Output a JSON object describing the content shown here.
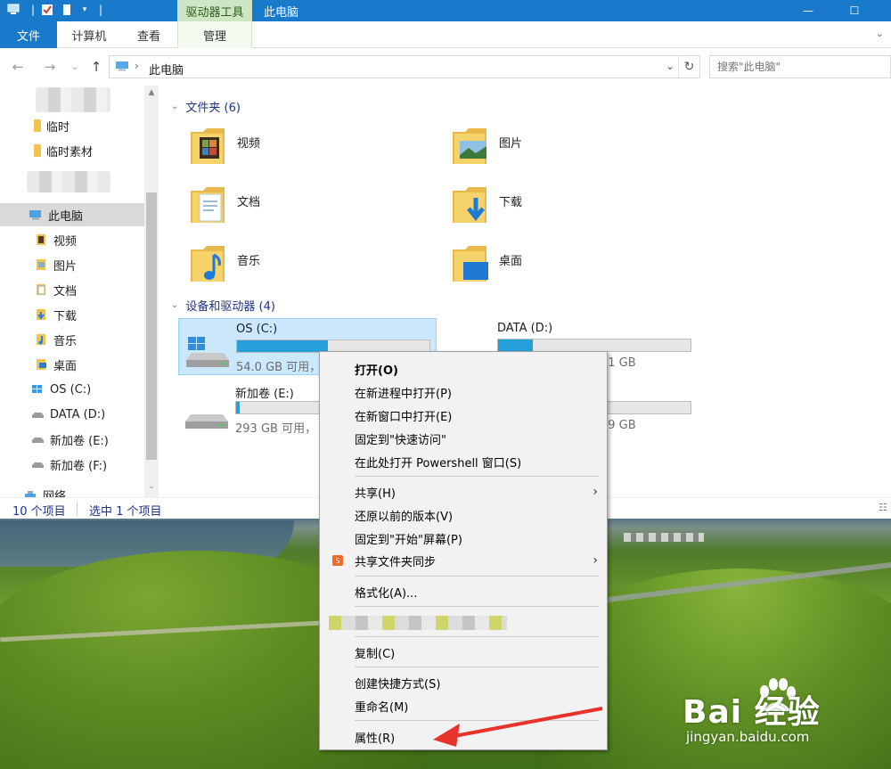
{
  "titlebar": {
    "context_tab": "驱动器工具",
    "title": "此电脑"
  },
  "ribbon": {
    "tabs": [
      {
        "label": "文件"
      },
      {
        "label": "计算机"
      },
      {
        "label": "查看"
      },
      {
        "label": "管理"
      }
    ]
  },
  "address": {
    "crumb": "此电脑",
    "search_placeholder": "搜索\"此电脑\""
  },
  "nav": {
    "quick": [
      {
        "label": "临时"
      },
      {
        "label": "临时素材"
      }
    ],
    "this_pc": "此电脑",
    "pc_items": [
      {
        "label": "视频"
      },
      {
        "label": "图片"
      },
      {
        "label": "文档"
      },
      {
        "label": "下载"
      },
      {
        "label": "音乐"
      },
      {
        "label": "桌面"
      },
      {
        "label": "OS (C:)"
      },
      {
        "label": "DATA (D:)"
      },
      {
        "label": "新加卷 (E:)"
      },
      {
        "label": "新加卷 (F:)"
      }
    ],
    "network": "网络"
  },
  "content": {
    "folders_header": "文件夹 (6)",
    "folders": [
      {
        "name": "视频",
        "icon": "video-folder-icon"
      },
      {
        "name": "图片",
        "icon": "pictures-folder-icon"
      },
      {
        "name": "文档",
        "icon": "documents-folder-icon"
      },
      {
        "name": "下载",
        "icon": "downloads-folder-icon"
      },
      {
        "name": "音乐",
        "icon": "music-folder-icon"
      },
      {
        "name": "桌面",
        "icon": "desktop-folder-icon"
      }
    ],
    "drives_header": "设备和驱动器 (4)",
    "drives": [
      {
        "name": "OS (C:)",
        "free": "54.0 GB 可用，",
        "used_fraction": 0.47
      },
      {
        "name": "DATA (D:)",
        "free": "31 GB",
        "used_fraction": 0.18
      },
      {
        "name": "新加卷 (E:)",
        "free": "293 GB 可用，",
        "used_fraction": 0.02
      },
      {
        "name": "",
        "free": "99 GB",
        "used_fraction": 0.0
      }
    ]
  },
  "status": {
    "count": "10 个项目",
    "selected": "选中 1 个项目"
  },
  "context_menu": {
    "items": [
      {
        "label": "打开(O)"
      },
      {
        "label": "在新进程中打开(P)"
      },
      {
        "label": "在新窗口中打开(E)"
      },
      {
        "label": "固定到\"快速访问\""
      },
      {
        "label": "在此处打开 Powershell 窗口(S)"
      },
      {
        "label": "共享(H)"
      },
      {
        "label": "还原以前的版本(V)"
      },
      {
        "label": "固定到\"开始\"屏幕(P)"
      },
      {
        "label": "共享文件夹同步"
      },
      {
        "label": "格式化(A)..."
      },
      {
        "label": "复制(C)"
      },
      {
        "label": "创建快捷方式(S)"
      },
      {
        "label": "重命名(M)"
      },
      {
        "label": "属性(R)"
      }
    ]
  },
  "watermark": {
    "logo": "Bai  经验",
    "url": "jingyan.baidu.com"
  },
  "colors": {
    "accent": "#1979ca",
    "context_tab": "#cfe6c5",
    "selection": "#cce8ff",
    "drive_bar": "#26a0da",
    "annotation_arrow": "#e8322c"
  }
}
